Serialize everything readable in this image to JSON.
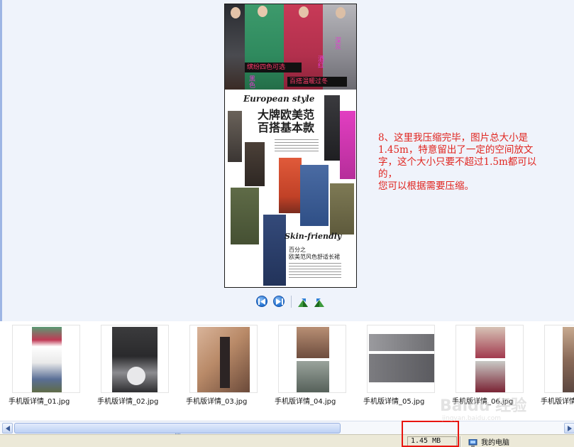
{
  "viewer": {
    "preview": {
      "image_text": {
        "overlay_line1": "缤纷四色可选",
        "overlay_line2": "百搭温暖过冬",
        "color_tag_1": "黑色",
        "color_tag_2": "酒红",
        "color_tag_3": "深灰",
        "magazine_title": "European style",
        "headline_line1": "大牌欧美范",
        "headline_line2": "百搭基本款",
        "subtitle": "Skin-friendly",
        "subtitle_cn_line1": "百分之",
        "subtitle_cn_line2": "欧美范风色舒适长裙"
      }
    },
    "note": {
      "line1": "8、这里我压缩完毕，图片总大小是",
      "line2": "1.45m，特意留出了一定的空间放文",
      "line3": "字，这个大小只要不超过1.5m都可以",
      "line4": "的，",
      "line5": "您可以根据需要压缩。"
    },
    "toolbar": {
      "previous_icon": "previous-image-icon",
      "next_icon": "next-image-icon",
      "rotate_cw_icon": "rotate-clockwise-icon",
      "rotate_ccw_icon": "rotate-counterclockwise-icon"
    },
    "filmstrip": {
      "thumbnails": [
        {
          "filename": "手机版详情_01.jpg"
        },
        {
          "filename": "手机版详情_02.jpg"
        },
        {
          "filename": "手机版详情_03.jpg"
        },
        {
          "filename": "手机版详情_04.jpg"
        },
        {
          "filename": "手机版详情_05.jpg"
        },
        {
          "filename": "手机版详情_06.jpg"
        },
        {
          "filename": "手机版详情"
        }
      ]
    },
    "status_bar": {
      "file_size": "1.45 MB",
      "location": "我的电脑"
    },
    "watermark": {
      "logo": "Baidu 经验",
      "url": "jingyan.baidu.com"
    },
    "colors": {
      "note_text": "#e0251f",
      "highlight_box": "#e8140f",
      "preview_background": "#eff3fb",
      "status_bar": "#ece9d8"
    }
  }
}
